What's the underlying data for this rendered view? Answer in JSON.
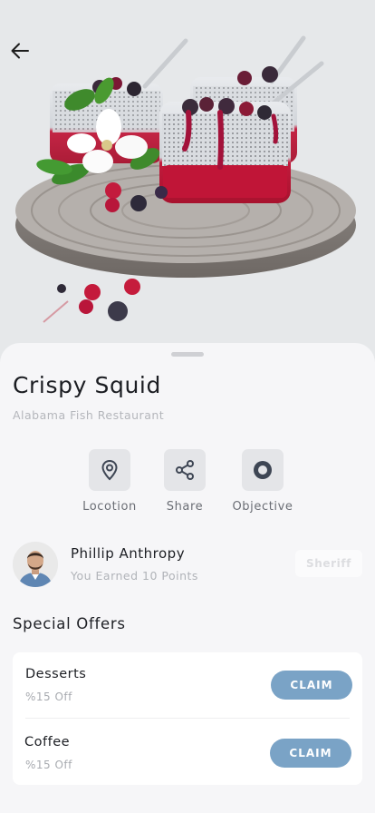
{
  "item": {
    "title": "Crispy Squid",
    "restaurant": "Alabama Fish Restaurant"
  },
  "actions": [
    {
      "label": "Locotion",
      "icon": "location-pin-icon"
    },
    {
      "label": "Share",
      "icon": "share-icon"
    },
    {
      "label": "Objective",
      "icon": "target-icon"
    }
  ],
  "user": {
    "name": "Phillip Anthropy",
    "points_text": "You Earned 10 Points",
    "badge": "Sheriff"
  },
  "offers": {
    "title": "Special Offers",
    "items": [
      {
        "name": "Desserts",
        "discount": "%15 Off",
        "button": "CLAIM"
      },
      {
        "name": "Coffee",
        "discount": "%15 Off",
        "button": "CLAIM"
      }
    ]
  },
  "colors": {
    "accent": "#7aa3c6",
    "icon_fill": "#3e4654",
    "background": "#f6f6f8"
  }
}
